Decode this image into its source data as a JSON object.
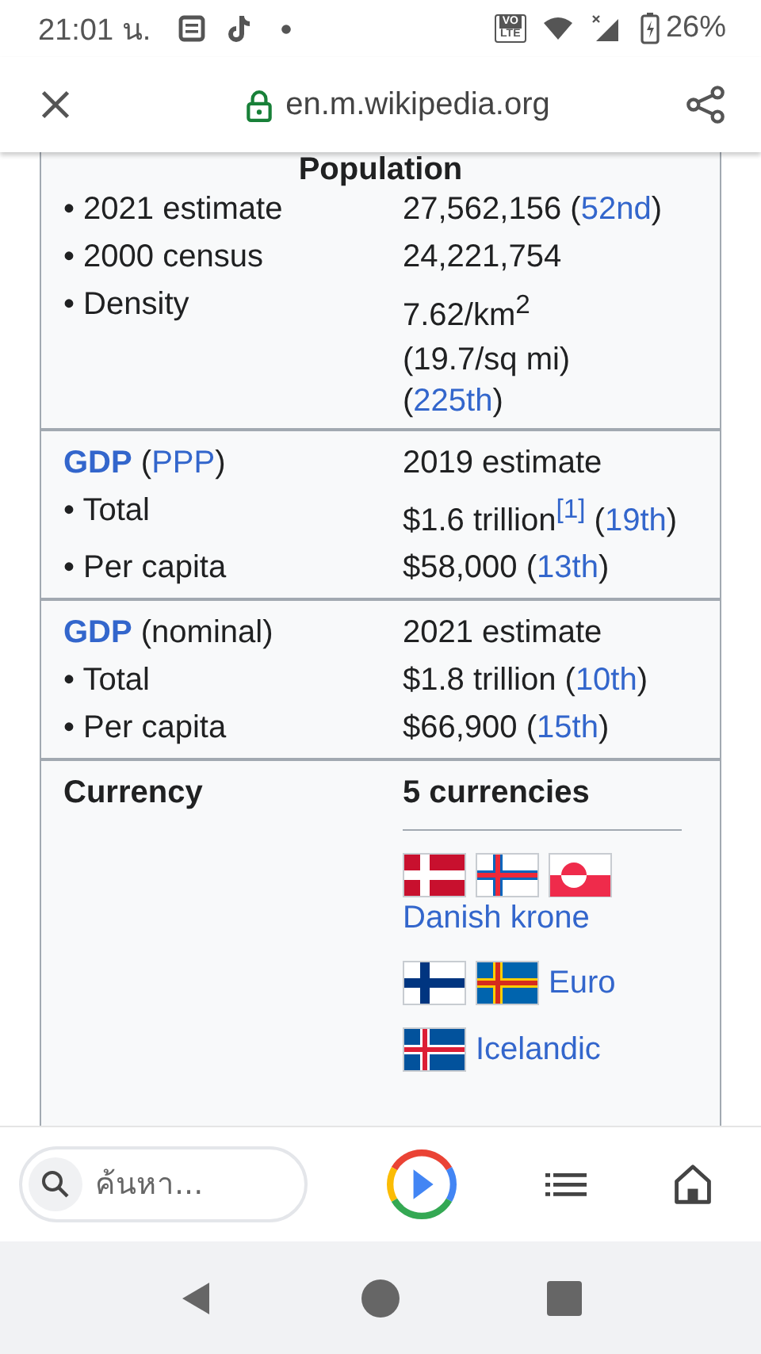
{
  "status_bar": {
    "time": "21:01 น.",
    "network_badge": [
      "VO",
      "LTE"
    ],
    "battery": "26%"
  },
  "top_bar": {
    "url": "en.m.wikipedia.org"
  },
  "infobox": {
    "sections": [
      {
        "title": "Population",
        "rows": [
          {
            "label": [
              {
                "text": "• 2021 estimate"
              }
            ],
            "value": [
              [
                {
                  "text": "27,562,156 ("
                },
                {
                  "text": "52nd",
                  "link": true
                },
                {
                  "text": ")"
                }
              ]
            ]
          },
          {
            "label": [
              {
                "text": "• 2000 census"
              }
            ],
            "value": [
              [
                {
                  "text": "24,221,754"
                }
              ]
            ]
          },
          {
            "label": [
              {
                "text": "• Density"
              }
            ],
            "value": [
              [
                {
                  "text": "7.62/km$^{2}$"
                }
              ],
              [
                {
                  "text": "(19.7/sq mi)"
                }
              ],
              [
                {
                  "text": "("
                },
                {
                  "text": "225th",
                  "link": true
                },
                {
                  "text": ")"
                }
              ]
            ]
          }
        ]
      },
      {
        "rows": [
          {
            "label": [
              {
                "text": "GDP",
                "link": true,
                "bold": true
              },
              {
                "text": " ("
              },
              {
                "text": "PPP",
                "link": true
              },
              {
                "text": ")"
              }
            ],
            "value": [
              [
                {
                  "text": "2019 estimate"
                }
              ]
            ]
          },
          {
            "label": [
              {
                "text": "• Total"
              }
            ],
            "value": [
              [
                {
                  "text": "$1.6 trillion"
                },
                {
                  "text": "$^{[1]}$",
                  "link": true
                },
                {
                  "text": " ("
                },
                {
                  "text": "19th",
                  "link": true
                },
                {
                  "text": ")"
                }
              ]
            ]
          },
          {
            "label": [
              {
                "text": "• Per capita"
              }
            ],
            "value": [
              [
                {
                  "text": "$58,000 ("
                },
                {
                  "text": "13th",
                  "link": true
                },
                {
                  "text": ")"
                }
              ]
            ]
          }
        ]
      },
      {
        "rows": [
          {
            "label": [
              {
                "text": "GDP",
                "link": true,
                "bold": true
              },
              {
                "text": " (nominal)"
              }
            ],
            "value": [
              [
                {
                  "text": "2021 estimate"
                }
              ]
            ]
          },
          {
            "label": [
              {
                "text": "• Total"
              }
            ],
            "value": [
              [
                {
                  "text": "$1.8 trillion ("
                },
                {
                  "text": "10th",
                  "link": true
                },
                {
                  "text": ")"
                }
              ]
            ]
          },
          {
            "label": [
              {
                "text": "• Per capita"
              }
            ],
            "value": [
              [
                {
                  "text": "$66,900 ("
                },
                {
                  "text": "15th",
                  "link": true
                },
                {
                  "text": ")"
                }
              ]
            ]
          }
        ]
      },
      {
        "rows": [
          {
            "label": [
              {
                "text": "Currency",
                "bold": true
              }
            ],
            "value": [
              [
                {
                  "text": "5 currencies",
                  "bold": true
                }
              ]
            ],
            "currencies": [
              {
                "flags": [
                  {
                    "kind": "denmark"
                  },
                  {
                    "kind": "faroe"
                  },
                  {
                    "kind": "greenland"
                  }
                ],
                "name": "Danish krone"
              },
              {
                "flags": [
                  {
                    "kind": "finland"
                  },
                  {
                    "kind": "aland"
                  }
                ],
                "name": "Euro"
              },
              {
                "flags": [
                  {
                    "kind": "iceland"
                  }
                ],
                "name": "Icelandic"
              }
            ]
          }
        ]
      }
    ]
  },
  "bottom_bar": {
    "search_placeholder": "ค้นหา..."
  }
}
